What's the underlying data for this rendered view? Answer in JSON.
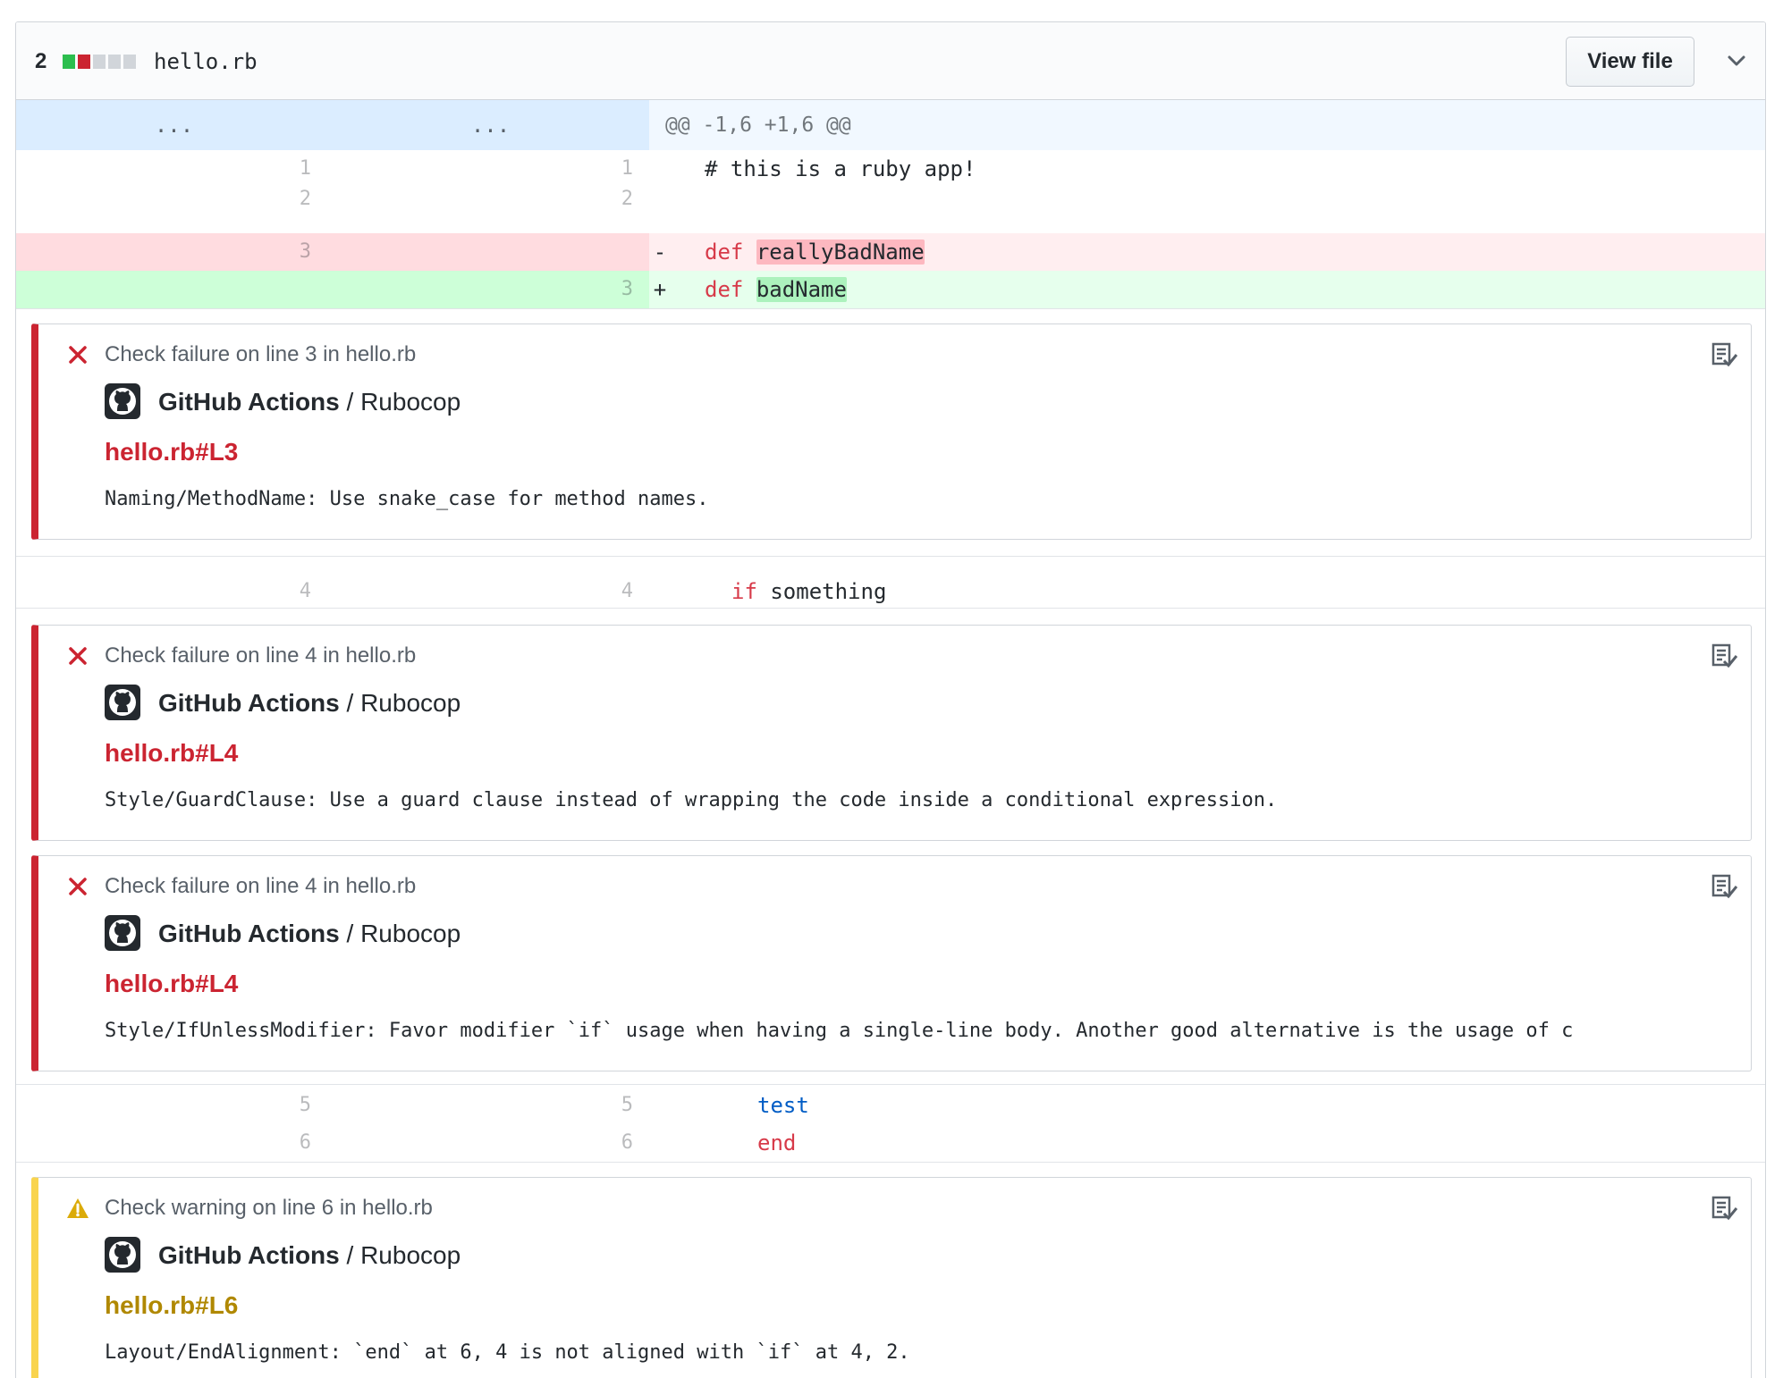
{
  "file": {
    "changes": "2",
    "diffstat": [
      "#2cbe4e",
      "#cb2431",
      "#d1d5da",
      "#d1d5da",
      "#d1d5da"
    ],
    "name": "hello.rb",
    "view_file_label": "View file",
    "collapse_icon": "chevron-down-icon"
  },
  "hunk": {
    "old_expander": "...",
    "new_expander": "...",
    "header": "@@ -1,6 +1,6 @@"
  },
  "lines": {
    "l1": {
      "old": "1",
      "new": "1",
      "code": "# this is a ruby app!"
    },
    "l2": {
      "old": "2",
      "new": "2",
      "code": ""
    },
    "del": {
      "old": "3",
      "marker": "-",
      "kw": "def",
      "name": "reallyBadName"
    },
    "add": {
      "new": "3",
      "marker": "+",
      "kw": "def",
      "name": "badName"
    },
    "l4": {
      "old": "4",
      "new": "4",
      "kw": "if",
      "rest": "something"
    },
    "l5": {
      "old": "5",
      "new": "5",
      "word": "test"
    },
    "l6": {
      "old": "6",
      "new": "6",
      "kw": "end"
    }
  },
  "annotations": [
    {
      "level": "failure",
      "status": "Check failure on line 3 in hello.rb",
      "app": "GitHub Actions",
      "separator": " / ",
      "check": "Rubocop",
      "link": "hello.rb#L3",
      "message": "Naming/MethodName: Use snake_case for method names."
    },
    {
      "level": "failure",
      "status": "Check failure on line 4 in hello.rb",
      "app": "GitHub Actions",
      "separator": " / ",
      "check": "Rubocop",
      "link": "hello.rb#L4",
      "message": "Style/GuardClause: Use a guard clause instead of wrapping the code inside a conditional expression."
    },
    {
      "level": "failure",
      "status": "Check failure on line 4 in hello.rb",
      "app": "GitHub Actions",
      "separator": " / ",
      "check": "Rubocop",
      "link": "hello.rb#L4",
      "message": "Style/IfUnlessModifier: Favor modifier `if` usage when having a single-line body. Another good alternative is the usage of c"
    },
    {
      "level": "warning",
      "status": "Check warning on line 6 in hello.rb",
      "app": "GitHub Actions",
      "separator": " / ",
      "check": "Rubocop",
      "link": "hello.rb#L6",
      "message": "Layout/EndAlignment: `end` at 6, 4 is not aligned with `if` at 4, 2."
    }
  ],
  "colors": {
    "failure": "#cb2431",
    "warning": "#f9d44e",
    "deleted_bg": "#ffeef0",
    "added_bg": "#e6ffed",
    "hunk_bg": "#f1f8ff"
  }
}
